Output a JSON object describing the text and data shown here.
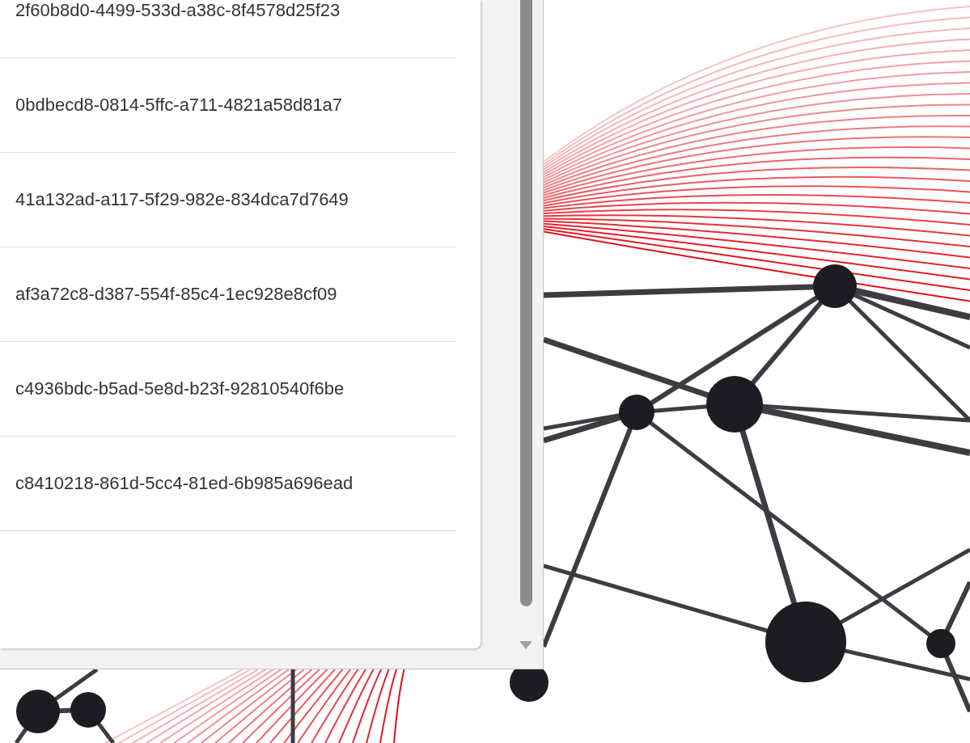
{
  "list": {
    "items": [
      {
        "text": "2f60b8d0-4499-533d-a38c-8f4578d25f23"
      },
      {
        "text": "0bdbecd8-0814-5ffc-a711-4821a58d81a7"
      },
      {
        "text": "41a132ad-a117-5f29-982e-834dca7d7649"
      },
      {
        "text": "af3a72c8-d387-554f-85c4-1ec928e8cf09"
      },
      {
        "text": "c4936bdc-b5ad-5e8d-b23f-92810540f6be"
      },
      {
        "text": "c8410218-861d-5cc4-81ed-6b985a696ead"
      }
    ]
  }
}
